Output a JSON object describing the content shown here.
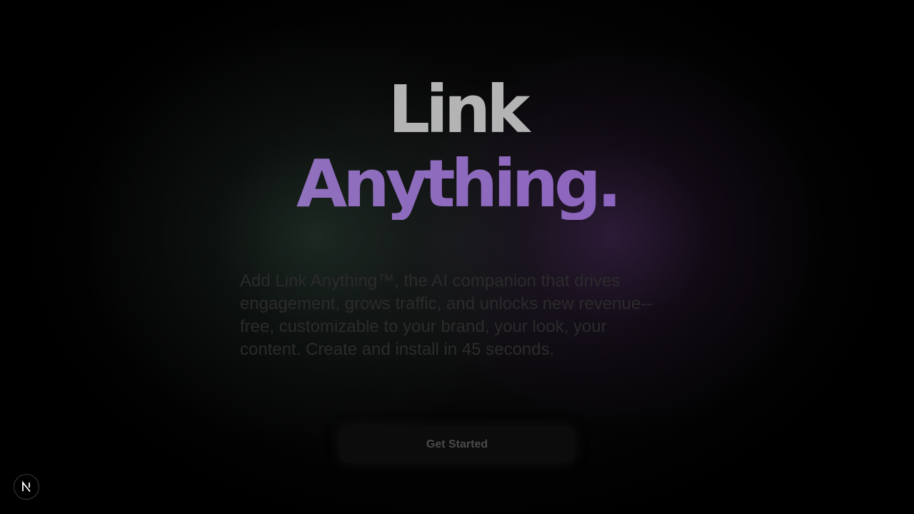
{
  "hero": {
    "title_line1": "Link",
    "title_line2": "Anything.",
    "tagline": "Add Link Anything™, the AI companion that drives engagement, grows traffic, and unlocks new revenue-- free, customizable to your brand, your look, your content. Create and install in 45 seconds.",
    "cta_label": "Get Started"
  },
  "badge": {
    "icon": "nextjs-logo-icon"
  },
  "colors": {
    "background": "#000000",
    "title_line1": "#b4b4b4",
    "title_line2_start": "#a69fc6",
    "title_line2_end": "#8a5cbf",
    "tagline": "#2b2b2b",
    "cta_text": "#4a4a4a"
  }
}
